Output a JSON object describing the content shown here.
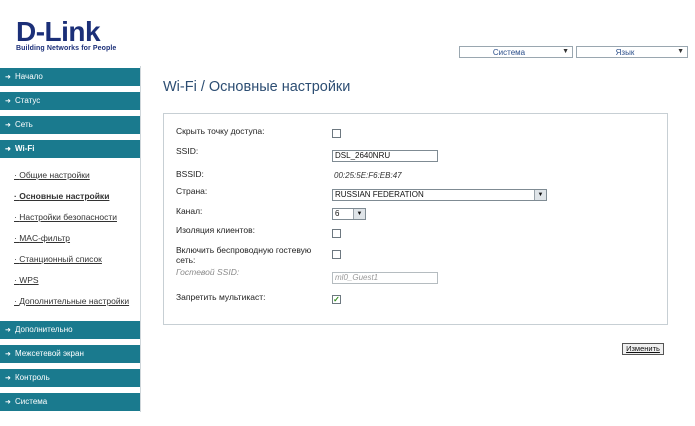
{
  "brand": {
    "name": "D-Link",
    "tagline": "Building Networks for People"
  },
  "top_selects": {
    "system": "Система",
    "language": "Язык"
  },
  "sidebar": {
    "items": [
      {
        "label": "Начало"
      },
      {
        "label": "Статус"
      },
      {
        "label": "Сеть"
      },
      {
        "label": "Wi-Fi",
        "active": true
      }
    ],
    "wifi_sub": [
      {
        "label": "Общие настройки"
      },
      {
        "label": "Основные настройки",
        "current": true
      },
      {
        "label": "Настройки безопасности"
      },
      {
        "label": "MAC-фильтр"
      },
      {
        "label": "Станционный список"
      },
      {
        "label": "WPS"
      },
      {
        "label": "Дополнительные настройки"
      }
    ],
    "bottom_items": [
      {
        "label": "Дополнительно"
      },
      {
        "label": "Межсетевой экран"
      },
      {
        "label": "Контроль"
      },
      {
        "label": "Система"
      }
    ]
  },
  "main": {
    "title": "Wi-Fi /  Основные настройки",
    "form": {
      "hide_ap_label": "Скрыть точку доступа:",
      "ssid_label": "SSID:",
      "ssid_value": "DSL_2640NRU",
      "bssid_label": "BSSID:",
      "bssid_value": "00:25:5E:F6:EB:47",
      "country_label": "Страна:",
      "country_value": "RUSSIAN FEDERATION",
      "channel_label": "Канал:",
      "channel_value": "6",
      "client_isolation_label": "Изоляция клиентов:",
      "guest_network_label_line1": "Включить беспроводную гостевую",
      "guest_network_label_line2": "сеть:",
      "guest_ssid_label": "Гостевой SSID:",
      "guest_ssid_value": "ml0_Guest1",
      "block_multicast_label": "Запретить мультикаст:",
      "checkmark": "✓"
    },
    "apply_label": "Изменить"
  }
}
